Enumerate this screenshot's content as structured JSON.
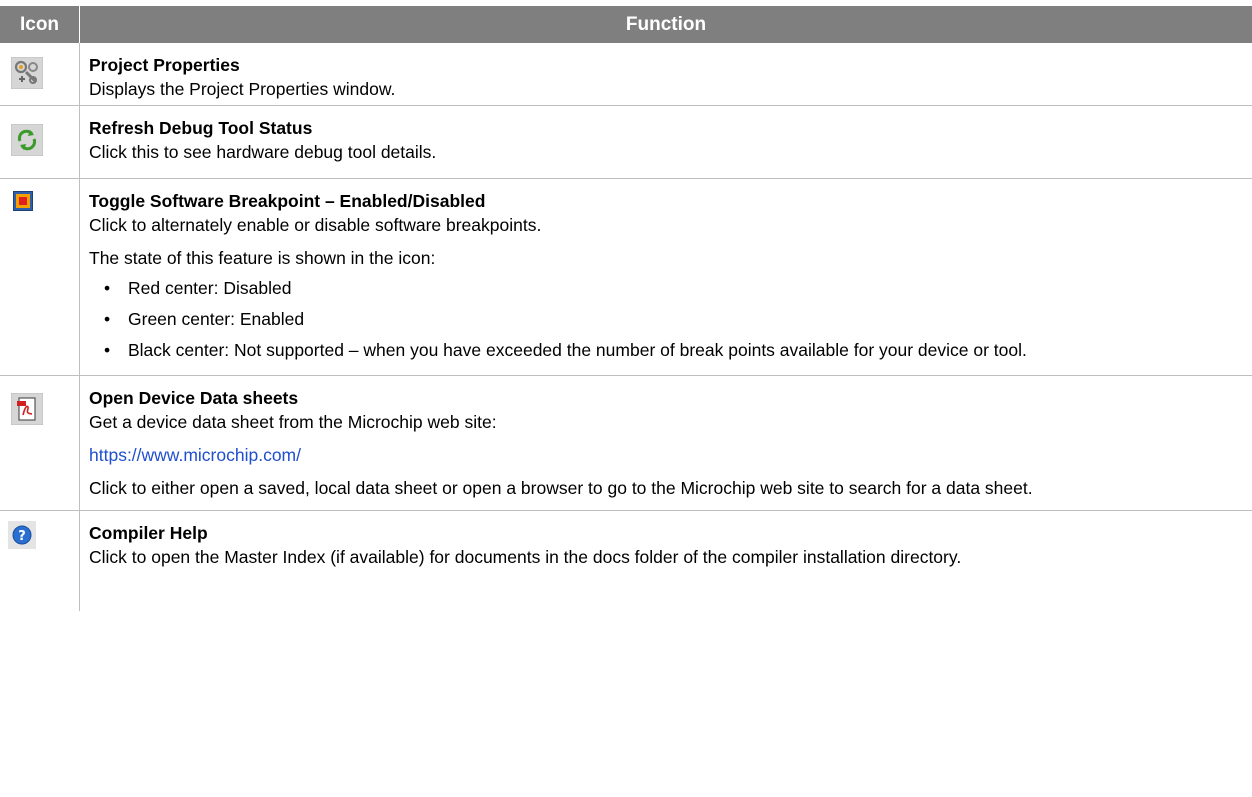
{
  "header": {
    "icon_col": "Icon",
    "function_col": "Function"
  },
  "rows": [
    {
      "icon": "project-properties-icon",
      "title": "Project Properties",
      "lines": [
        "Displays the Project Properties window."
      ]
    },
    {
      "icon": "refresh-icon",
      "title": "Refresh Debug Tool Status",
      "lines": [
        "Click this to see hardware debug tool details."
      ]
    },
    {
      "icon": "breakpoint-toggle-icon",
      "title": "Toggle Software Breakpoint – Enabled/Disabled",
      "lines": [
        "Click to alternately enable or disable software breakpoints.",
        "The state of this feature is shown in the icon:"
      ],
      "bullets": [
        "Red center: Disabled",
        "Green center: Enabled",
        "Black center: Not supported – when you have exceeded the number of break points available for your device or tool."
      ]
    },
    {
      "icon": "pdf-datasheet-icon",
      "title": "Open Device Data sheets",
      "lines": [
        "Get a device data sheet from the Microchip web site:",
        "https://www.microchip.com/",
        "Click to either open a saved, local data sheet or open a browser to go to the Microchip web site to search for a data sheet."
      ]
    },
    {
      "icon": "help-icon",
      "title": "Compiler Help",
      "lines": [
        "Click to open the Master Index (if available) for documents in the docs folder of the compiler installation directory."
      ]
    }
  ],
  "colors": {
    "header_bg": "#7f7f7f",
    "link": "#1f4fcf",
    "grid": "#bfbfbf"
  }
}
